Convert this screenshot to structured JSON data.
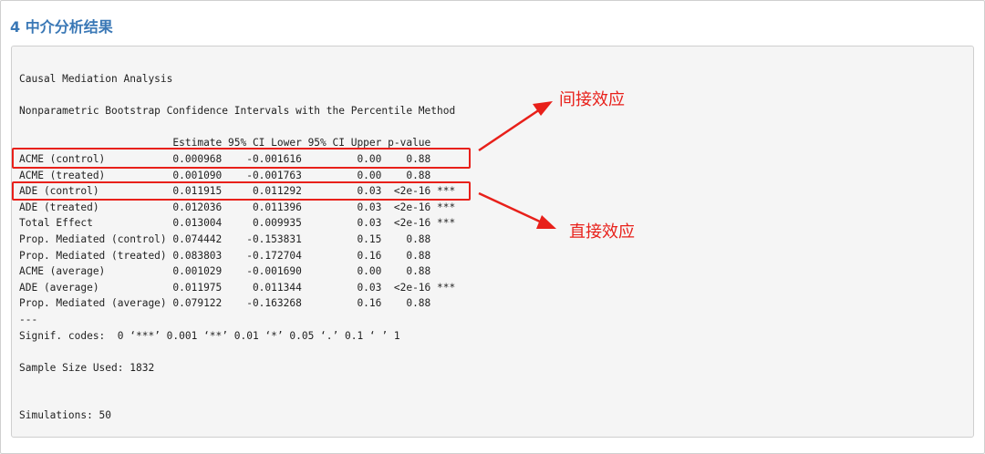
{
  "section": {
    "title": "4 中介分析结果"
  },
  "output": {
    "header": "Causal Mediation Analysis",
    "method": "Nonparametric Bootstrap Confidence Intervals with the Percentile Method",
    "table_header": "                         Estimate 95% CI Lower 95% CI Upper p-value",
    "rows": [
      "ACME (control)           0.000968    -0.001616         0.00    0.88",
      "ACME (treated)           0.001090    -0.001763         0.00    0.88",
      "ADE (control)            0.011915     0.011292         0.03  <2e-16 ***",
      "ADE (treated)            0.012036     0.011396         0.03  <2e-16 ***",
      "Total Effect             0.013004     0.009935         0.03  <2e-16 ***",
      "Prop. Mediated (control) 0.074442    -0.153831         0.15    0.88",
      "Prop. Mediated (treated) 0.083803    -0.172704         0.16    0.88",
      "ACME (average)           0.001029    -0.001690         0.00    0.88",
      "ADE (average)            0.011975     0.011344         0.03  <2e-16 ***",
      "Prop. Mediated (average) 0.079122    -0.163268         0.16    0.88"
    ],
    "separator": "---",
    "signif_codes": "Signif. codes:  0 ‘***’ 0.001 ‘**’ 0.01 ‘*’ 0.05 ‘.’ 0.1 ‘ ’ 1",
    "sample_size": "Sample Size Used: 1832",
    "simulations": "Simulations: 50"
  },
  "annotations": {
    "indirect_effect": "间接效应",
    "direct_effect": "直接效应",
    "color": "#e8201a"
  }
}
